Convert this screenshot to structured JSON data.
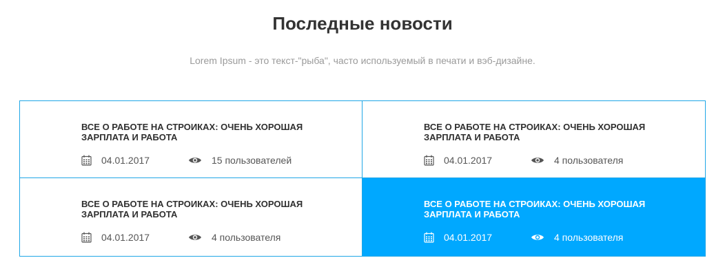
{
  "section": {
    "title": "Последные новости",
    "subtitle": "Lorem Ipsum - это текст-\"рыба\", часто используемый в печати и вэб-дизайне."
  },
  "news": [
    {
      "title": "Все о работе на строиках: очень хорошая зарплата и работа",
      "date": "04.01.2017",
      "views": "15 пользователей",
      "active": false
    },
    {
      "title": "Все о работе на строиках: очень хорошая зарплата и работа",
      "date": "04.01.2017",
      "views": "4 пользователя",
      "active": false
    },
    {
      "title": "Все о работе на строиках: очень хорошая зарплата и работа",
      "date": "04.01.2017",
      "views": "4 пользователя",
      "active": false
    },
    {
      "title": "Все о работе на строиках: очень хорошая зарплата и работа",
      "date": "04.01.2017",
      "views": "4 пользователя",
      "active": true
    }
  ],
  "icons": {
    "date": "calendar-icon",
    "views": "eye-icon"
  },
  "colors": {
    "accent": "#00a8ff",
    "border": "#1ea6e6",
    "title": "#333333",
    "subtitle": "#9a9a9a"
  }
}
